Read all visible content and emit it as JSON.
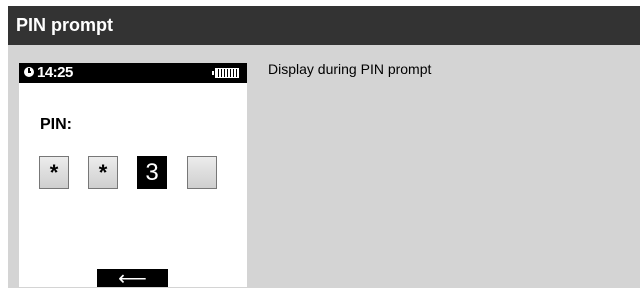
{
  "header": {
    "title": "PIN prompt"
  },
  "device": {
    "status_bar": {
      "time": "14:25",
      "clock_icon": "clock-icon",
      "battery_icon": "battery-icon"
    },
    "pin_label": "PIN:",
    "pin_fields": [
      "*",
      "*",
      "3",
      ""
    ],
    "active_field_index": 2,
    "back_button": {
      "label": "⟵",
      "icon": "back-arrow-icon"
    }
  },
  "description": "Display during PIN prompt",
  "colors": {
    "title_bar": "#333333",
    "panel": "#d4d4d4",
    "screen": "#ffffff",
    "active": "#000000"
  }
}
